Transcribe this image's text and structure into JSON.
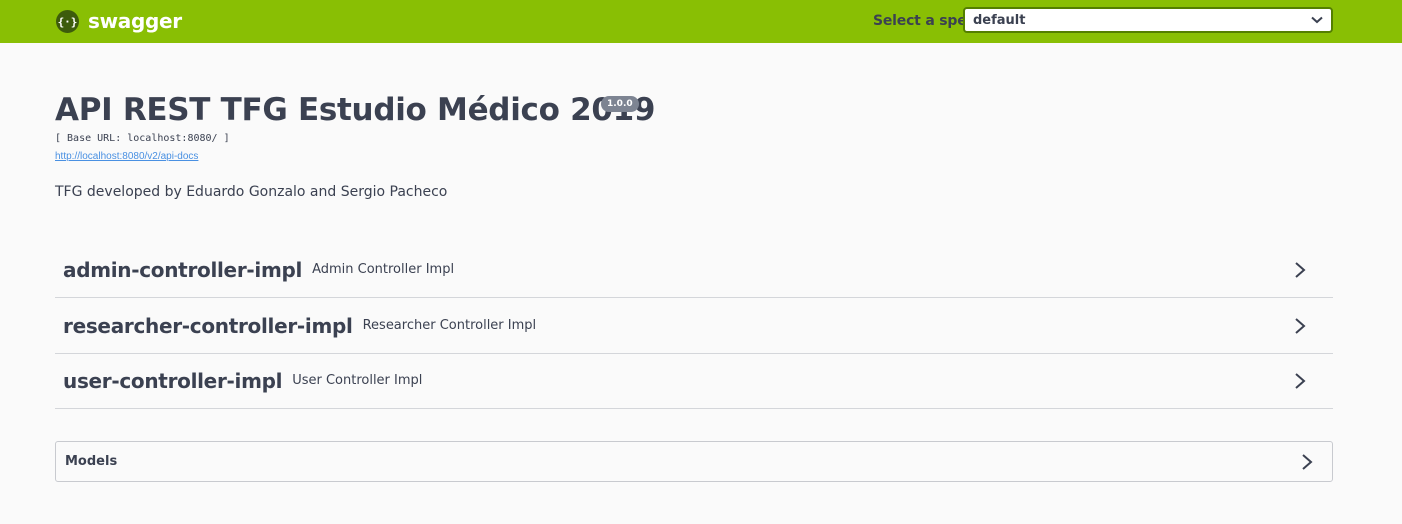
{
  "topbar": {
    "brand": "swagger",
    "spec_label": "Select a spec",
    "spec_selected": "default",
    "accent_color": "#89bf04"
  },
  "info": {
    "title": "API REST TFG Estudio Médico 2019",
    "version": "1.0.0",
    "base_url": "[ Base URL: localhost:8080/ ]",
    "docs_url": "http://localhost:8080/v2/api-docs",
    "description": "TFG developed by Eduardo Gonzalo and Sergio Pacheco"
  },
  "tags": [
    {
      "name": "admin-controller-impl",
      "description": "Admin Controller Impl"
    },
    {
      "name": "researcher-controller-impl",
      "description": "Researcher Controller Impl"
    },
    {
      "name": "user-controller-impl",
      "description": "User Controller Impl"
    }
  ],
  "models": {
    "label": "Models"
  },
  "icons": {
    "logo": "swagger-logo-icon",
    "select_arrow": "chevron-down-icon",
    "expand": "chevron-right-icon"
  }
}
